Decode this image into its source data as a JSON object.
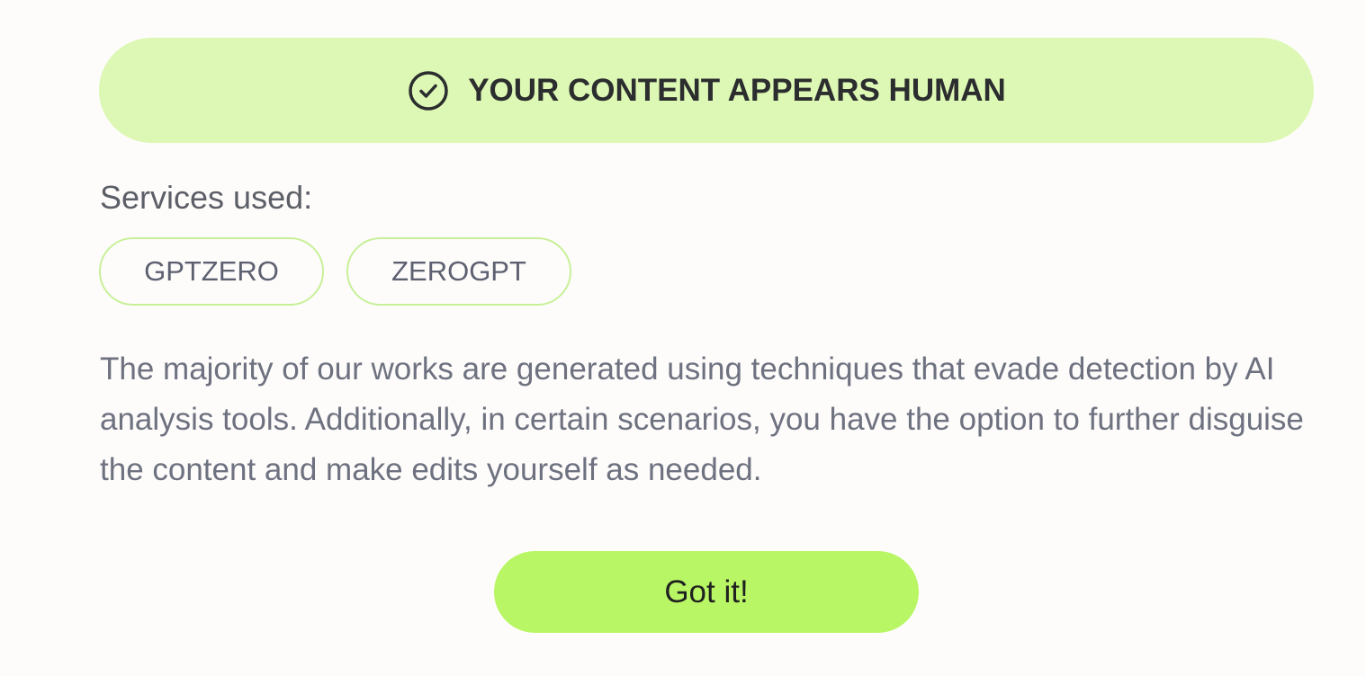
{
  "banner": {
    "icon": "check-circle-icon",
    "text": "YOUR CONTENT APPEARS HUMAN",
    "background": "#ddf8b4"
  },
  "services": {
    "label": "Services used:",
    "items": [
      "GPTZERO",
      "ZEROGPT"
    ]
  },
  "description": "The majority of our works are generated using techniques that evade detection by AI analysis tools. Additionally, in certain scenarios, you have the option to further disguise the content and make edits yourself as needed.",
  "actions": {
    "confirm_label": "Got it!",
    "confirm_color": "#b9f665"
  }
}
